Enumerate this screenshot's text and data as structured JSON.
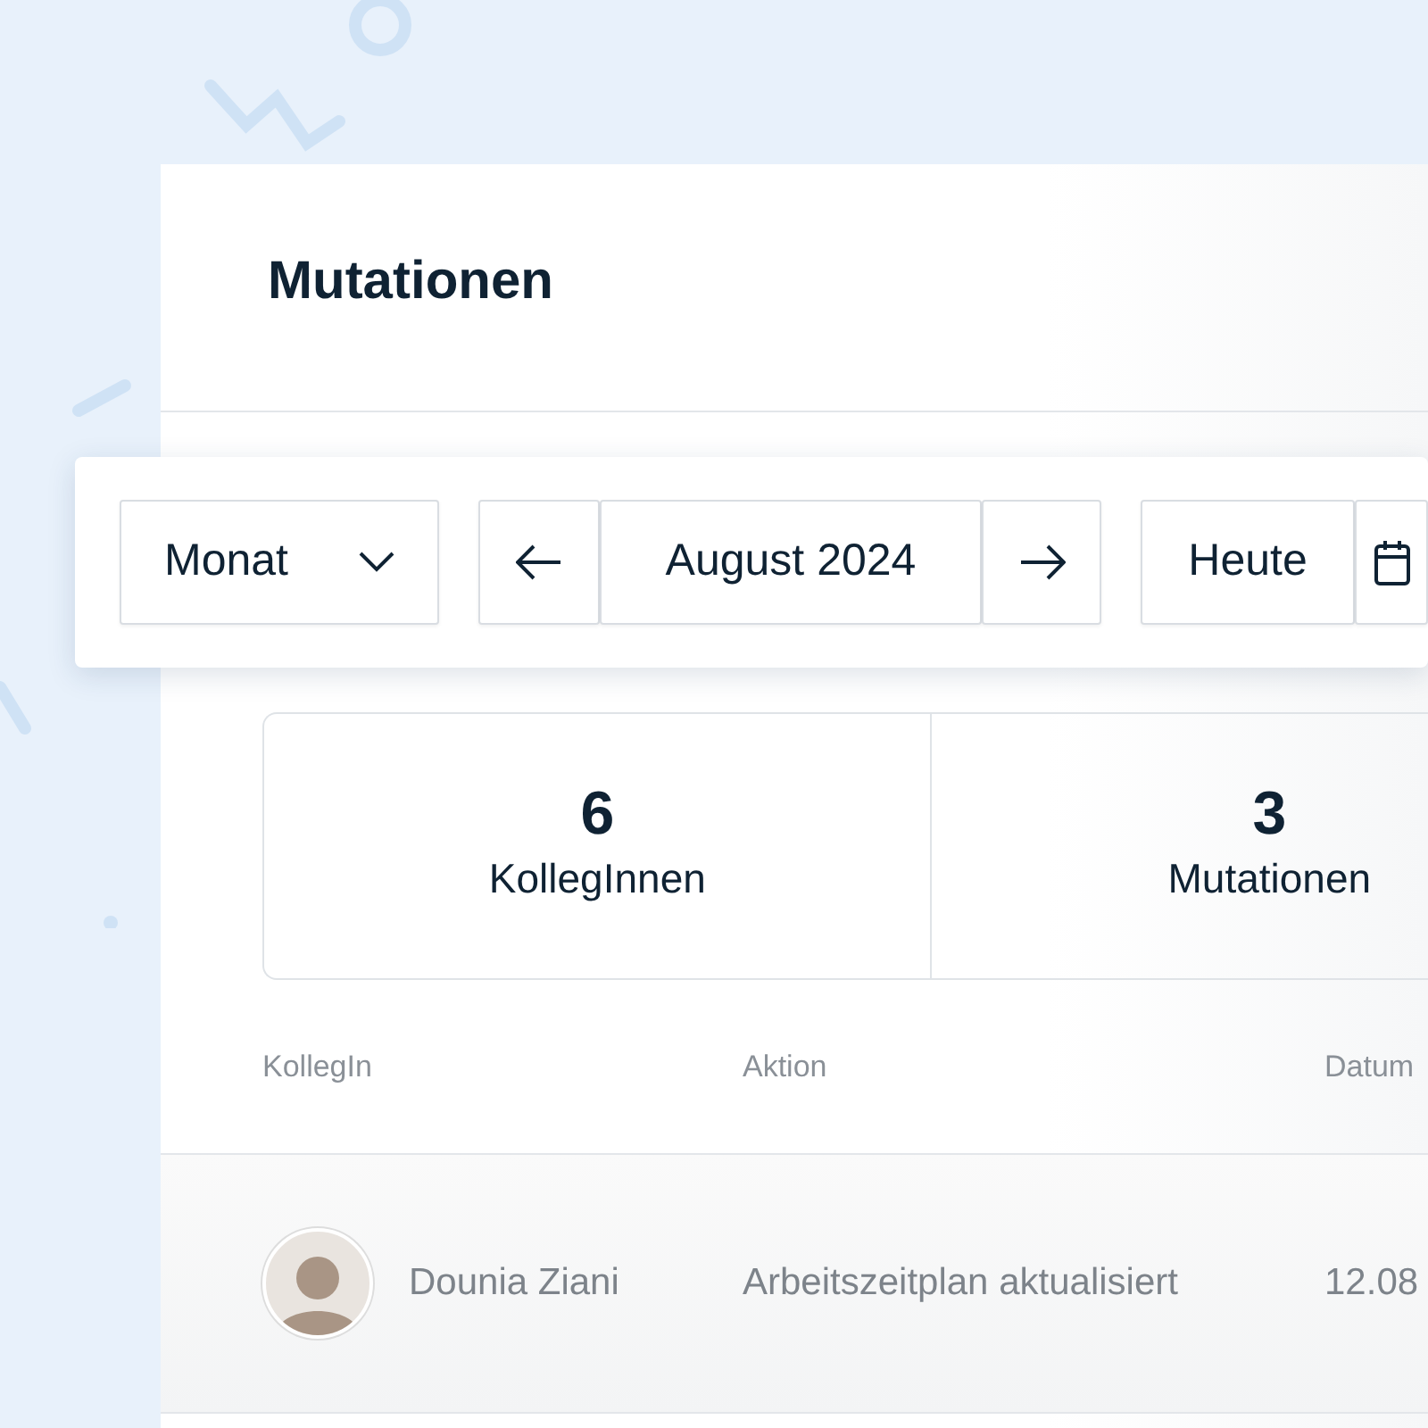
{
  "title": "Mutationen",
  "toolbar": {
    "period": "Monat",
    "month": "August 2024",
    "today": "Heute"
  },
  "stats": [
    {
      "value": "6",
      "label": "KollegInnen"
    },
    {
      "value": "3",
      "label": "Mutationen"
    }
  ],
  "table": {
    "columns": [
      "KollegIn",
      "Aktion",
      "Datum"
    ],
    "rows": [
      {
        "name": "Dounia Ziani",
        "action": "Arbeitszeitplan aktualisiert",
        "date": "12.08"
      }
    ]
  }
}
